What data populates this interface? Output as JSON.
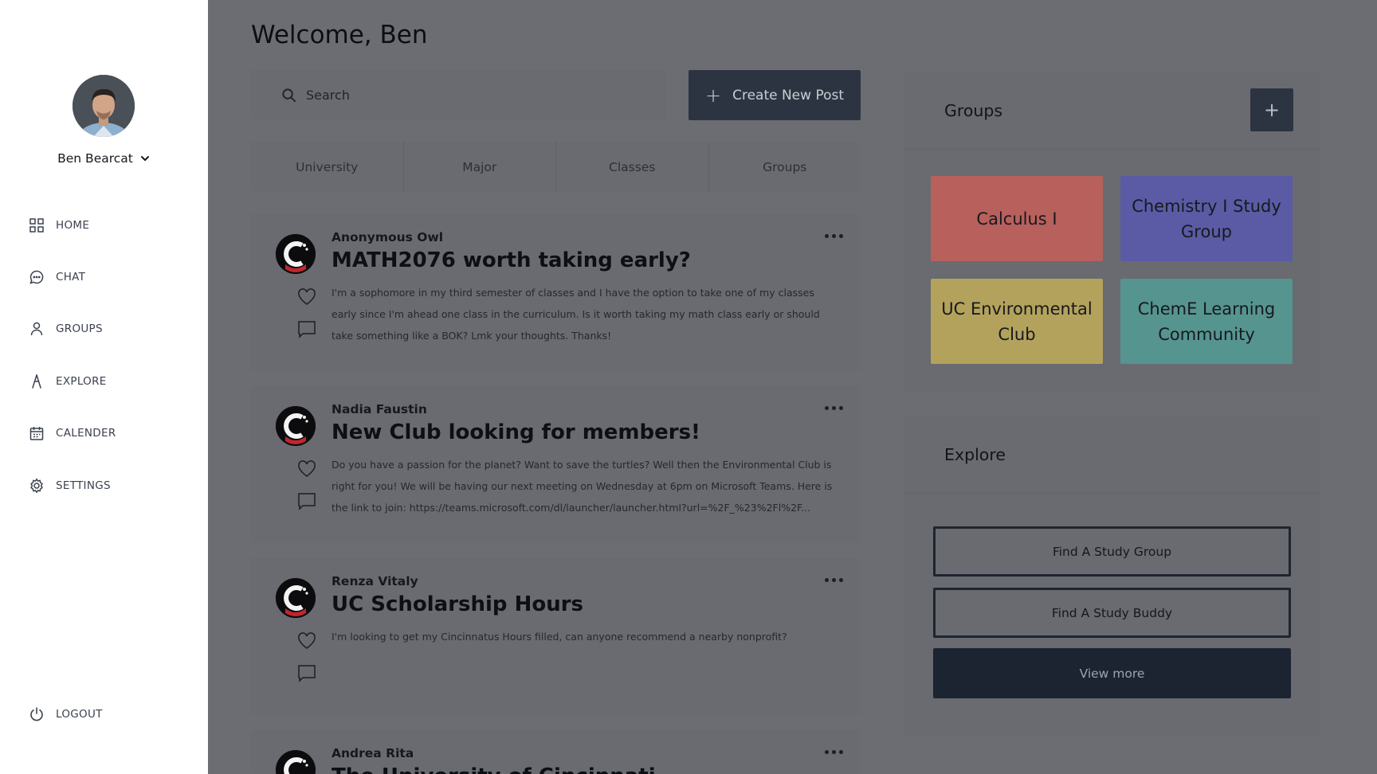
{
  "user": {
    "name": "Ben Bearcat"
  },
  "nav": {
    "home": "HOME",
    "chat": "CHAT",
    "groups": "GROUPS",
    "explore": "EXPLORE",
    "calender": "CALENDER",
    "settings": "SETTINGS",
    "logout": "LOGOUT"
  },
  "main": {
    "welcome": "Welcome, Ben",
    "search_placeholder": "Search",
    "create_label": "Create New Post",
    "tabs": [
      "University",
      "Major",
      "Classes",
      "Groups"
    ]
  },
  "posts": [
    {
      "author": "Anonymous Owl",
      "title": "MATH2076 worth taking early?",
      "body": "I'm a sophomore in my third semester of classes and I have the option to take one of my classes early since I'm ahead one class in the curriculum. Is it worth taking my math class early or should take something like a BOK? Lmk your thoughts. Thanks!"
    },
    {
      "author": "Nadia Faustin",
      "title": "New Club looking for members!",
      "body": "Do you have a passion for the planet? Want to save the turtles? Well then the Environmental Club is right for you! We will be having our next meeting on Wednesday at 6pm on Microsoft Teams. Here is the link to join: https://teams.microsoft.com/dl/launcher/launcher.html?url=%2F_%23%2Fl%2F..."
    },
    {
      "author": "Renza Vitaly",
      "title": "UC Scholarship Hours",
      "body": "I'm looking to get my Cincinnatus Hours filled, can anyone recommend a nearby nonprofit?"
    },
    {
      "author": "Andrea Rita",
      "title": "The University of Cincinnati",
      "body": ""
    }
  ],
  "groups_panel": {
    "title": "Groups",
    "add_label": "+",
    "tiles": [
      {
        "name": "Calculus I",
        "color": "#b8605c"
      },
      {
        "name": "Chemistry I Study Group",
        "color": "#5a5ba4"
      },
      {
        "name": "UC Environmental Club",
        "color": "#b3a25c"
      },
      {
        "name": "ChemE Learning Community",
        "color": "#56948f"
      }
    ]
  },
  "explore_panel": {
    "title": "Explore",
    "find_group": "Find A Study Group",
    "find_buddy": "Find A Study Buddy",
    "view_more": "View more"
  }
}
